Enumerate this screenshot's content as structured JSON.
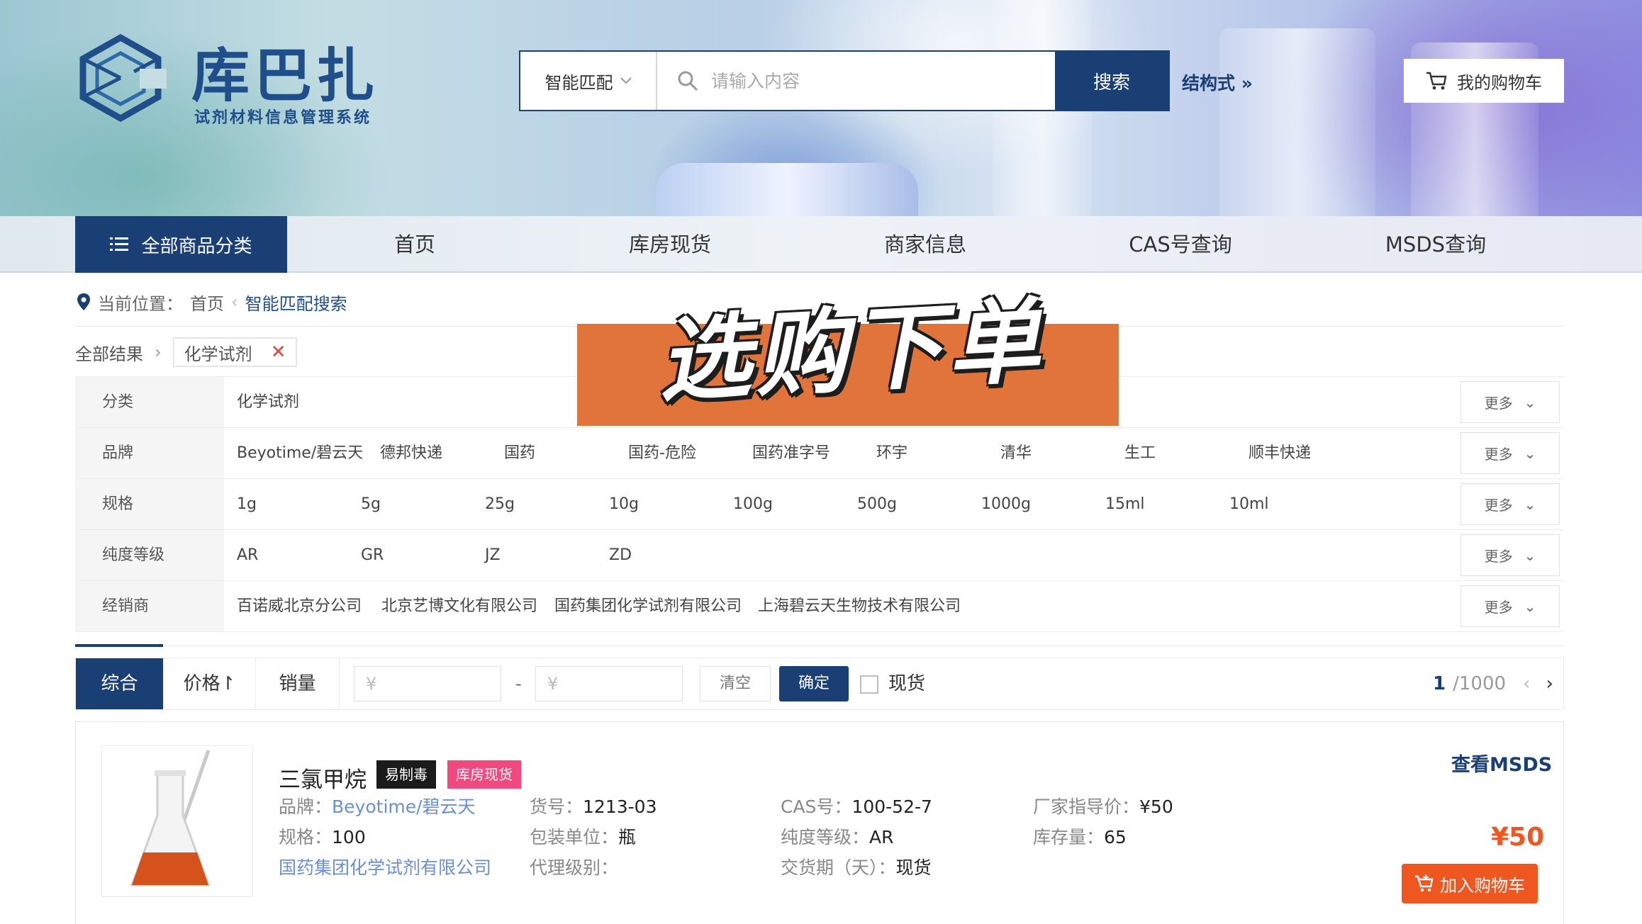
{
  "brand": {
    "name": "库巴扎",
    "subtitle": "试剂材料信息管理系统"
  },
  "search": {
    "type_label": "智能匹配",
    "placeholder": "请输入内容",
    "button": "搜索",
    "structure_link": "结构式 »"
  },
  "cart": {
    "label": "我的购物车"
  },
  "nav": {
    "all_categories": "全部商品分类",
    "items": [
      "首页",
      "库房现货",
      "商家信息",
      "CAS号查询",
      "MSDS查询"
    ]
  },
  "breadcrumb": {
    "prefix": "当前位置：",
    "home": "首页",
    "current": "智能匹配搜索"
  },
  "filter_path": {
    "all": "全部结果",
    "tag": "化学试剂",
    "tag_close": "✕"
  },
  "filters": {
    "more_label": "更多",
    "rows": [
      {
        "label": "分类",
        "values": [
          "化学试剂"
        ]
      },
      {
        "label": "品牌",
        "values": [
          "Beyotime/碧云天",
          "德邦快递",
          "国药",
          "国药-危险",
          "国药准字号",
          "环宇",
          "清华",
          "生工",
          "顺丰快递"
        ]
      },
      {
        "label": "规格",
        "values": [
          "1g",
          "5g",
          "25g",
          "10g",
          "100g",
          "500g",
          "1000g",
          "15ml",
          "10ml"
        ]
      },
      {
        "label": "纯度等级",
        "values": [
          "AR",
          "GR",
          "JZ",
          "ZD"
        ]
      },
      {
        "label": "经销商",
        "values": [
          "百诺威北京分公司",
          "北京艺博文化有限公司",
          "国药集团化学试剂有限公司",
          "上海碧云天生物技术有限公司"
        ]
      }
    ]
  },
  "overlay": {
    "text": "选购下单"
  },
  "sort": {
    "tabs": [
      "综合",
      "价格↾",
      "销量"
    ],
    "price_min_placeholder": "¥",
    "price_max_placeholder": "¥",
    "dash": "-",
    "clear": "清空",
    "confirm": "确定",
    "in_stock": "现货",
    "page_current": "1",
    "page_total": "/1000"
  },
  "product": {
    "name": "三氯甲烷",
    "badges": [
      "易制毒",
      "库房现货"
    ],
    "brand_label": "品牌：",
    "brand": "Beyotime/碧云天",
    "spec_label": "规格：",
    "spec": "100",
    "dealer": "国药集团化学试剂有限公司",
    "sku_label": "货号：",
    "sku": "1213-03",
    "unit_label": "包装单位：",
    "unit": "瓶",
    "agent_label": "代理级别：",
    "cas_label": "CAS号：",
    "cas": "100-52-7",
    "purity_label": "纯度等级：",
    "purity": "AR",
    "delivery_label": "交货期（天）：",
    "delivery": "现货",
    "guide_price_label": "厂家指导价：",
    "guide_price": "¥50",
    "stock_label": "库存量：",
    "stock": "65",
    "msds_link": "查看MSDS",
    "price": "¥50",
    "add_to_cart": "加入购物车"
  },
  "colors": {
    "primary": "#1a3f74",
    "accent": "#f0561f",
    "badge_dark": "#1b1b1b",
    "badge_pink": "#f0487f"
  }
}
